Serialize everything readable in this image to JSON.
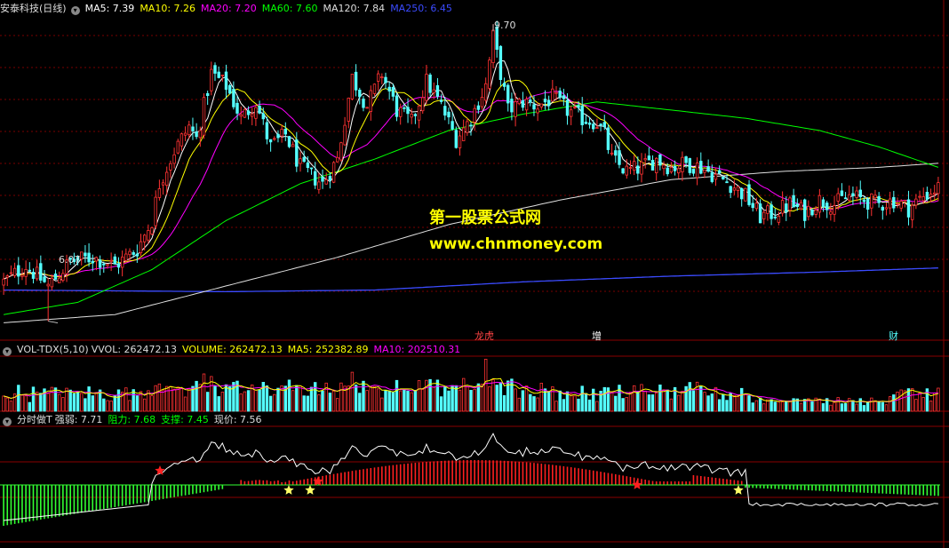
{
  "colors": {
    "up": "#ff3232",
    "down": "#54ffff",
    "ma5": "#ffffff",
    "ma10": "#ffff00",
    "ma20": "#ff00ff",
    "ma60": "#00ff00",
    "ma120": "#e0e0e0",
    "ma250": "#3b4bff",
    "grid": "#7a0000"
  },
  "header": {
    "stock": "安泰科技(日线)",
    "ma5": "MA5: 7.39",
    "ma10": "MA10: 7.26",
    "ma20": "MA20: 7.20",
    "ma60": "MA60: 7.60",
    "ma120": "MA120: 7.84",
    "ma250": "MA250: 6.45"
  },
  "watermark": {
    "line1": "第一股票公式网",
    "line2": "www.chnmoney.com"
  },
  "price_labels": {
    "high": "9.70",
    "low": "6.07"
  },
  "events": [
    {
      "label": "龙虎",
      "x": 540
    },
    {
      "label": "增",
      "x": 668
    },
    {
      "label": "财",
      "x": 1002
    }
  ],
  "vol_header": {
    "name": "VOL-TDX(5,10)",
    "vvol": "VVOL: 262472.13",
    "volume": "VOLUME: 262472.13",
    "ma5": "MA5: 252382.89",
    "ma10": "MA10: 202510.31"
  },
  "ind_header": {
    "name": "分时做T",
    "strength": "强弱: 7.71",
    "resistance": "阻力: 7.68",
    "support": "支撑: 7.45",
    "current": "现价: 7.56"
  },
  "chart_data": {
    "type": "candlestick",
    "price_range": [
      6.0,
      9.8
    ],
    "price_high": 9.7,
    "price_low": 6.07,
    "keypoints": [
      [
        0,
        6.55
      ],
      [
        6,
        6.75
      ],
      [
        12,
        6.5
      ],
      [
        18,
        6.8
      ],
      [
        24,
        6.85
      ],
      [
        30,
        6.75
      ],
      [
        36,
        6.95
      ],
      [
        40,
        7.3
      ],
      [
        42,
        7.75
      ],
      [
        46,
        8.15
      ],
      [
        50,
        8.45
      ],
      [
        52,
        8.3
      ],
      [
        56,
        9.1
      ],
      [
        60,
        8.95
      ],
      [
        64,
        8.55
      ],
      [
        68,
        8.75
      ],
      [
        72,
        8.2
      ],
      [
        76,
        8.35
      ],
      [
        80,
        7.95
      ],
      [
        86,
        7.75
      ],
      [
        90,
        8.05
      ],
      [
        94,
        9.05
      ],
      [
        98,
        8.7
      ],
      [
        102,
        9.1
      ],
      [
        106,
        8.65
      ],
      [
        110,
        8.5
      ],
      [
        114,
        9.0
      ],
      [
        118,
        8.7
      ],
      [
        122,
        8.3
      ],
      [
        126,
        8.55
      ],
      [
        130,
        8.95
      ],
      [
        132,
        9.55
      ],
      [
        136,
        8.65
      ],
      [
        140,
        8.75
      ],
      [
        144,
        8.7
      ],
      [
        148,
        8.8
      ],
      [
        152,
        8.65
      ],
      [
        156,
        8.55
      ],
      [
        160,
        8.5
      ],
      [
        162,
        8.35
      ],
      [
        164,
        8.05
      ],
      [
        168,
        7.9
      ],
      [
        172,
        7.95
      ],
      [
        176,
        8.05
      ],
      [
        180,
        7.95
      ],
      [
        184,
        8.0
      ],
      [
        188,
        7.95
      ],
      [
        192,
        7.85
      ],
      [
        196,
        7.75
      ],
      [
        200,
        7.6
      ],
      [
        204,
        7.35
      ],
      [
        208,
        7.4
      ],
      [
        212,
        7.5
      ],
      [
        216,
        7.4
      ],
      [
        220,
        7.55
      ],
      [
        224,
        7.5
      ],
      [
        228,
        7.6
      ],
      [
        232,
        7.55
      ],
      [
        236,
        7.5
      ],
      [
        240,
        7.55
      ],
      [
        244,
        7.45
      ],
      [
        248,
        7.6
      ],
      [
        252,
        7.7
      ]
    ],
    "ma60_points": [
      [
        0,
        6.15
      ],
      [
        20,
        6.3
      ],
      [
        40,
        6.7
      ],
      [
        60,
        7.3
      ],
      [
        80,
        7.75
      ],
      [
        100,
        8.05
      ],
      [
        120,
        8.4
      ],
      [
        140,
        8.6
      ],
      [
        160,
        8.75
      ],
      [
        180,
        8.65
      ],
      [
        200,
        8.55
      ],
      [
        220,
        8.4
      ],
      [
        236,
        8.2
      ],
      [
        252,
        7.95
      ]
    ],
    "ma120_points": [
      [
        0,
        6.05
      ],
      [
        30,
        6.15
      ],
      [
        60,
        6.5
      ],
      [
        90,
        6.85
      ],
      [
        120,
        7.25
      ],
      [
        150,
        7.55
      ],
      [
        180,
        7.8
      ],
      [
        210,
        7.9
      ],
      [
        236,
        7.95
      ],
      [
        252,
        8.0
      ]
    ],
    "ma250_points": [
      [
        0,
        6.45
      ],
      [
        60,
        6.43
      ],
      [
        100,
        6.45
      ],
      [
        140,
        6.55
      ],
      [
        180,
        6.62
      ],
      [
        220,
        6.67
      ],
      [
        252,
        6.72
      ]
    ],
    "volume_range": [
      0,
      500000
    ],
    "indicator": {
      "type": "histogram",
      "series": [
        "green",
        "red"
      ]
    }
  }
}
